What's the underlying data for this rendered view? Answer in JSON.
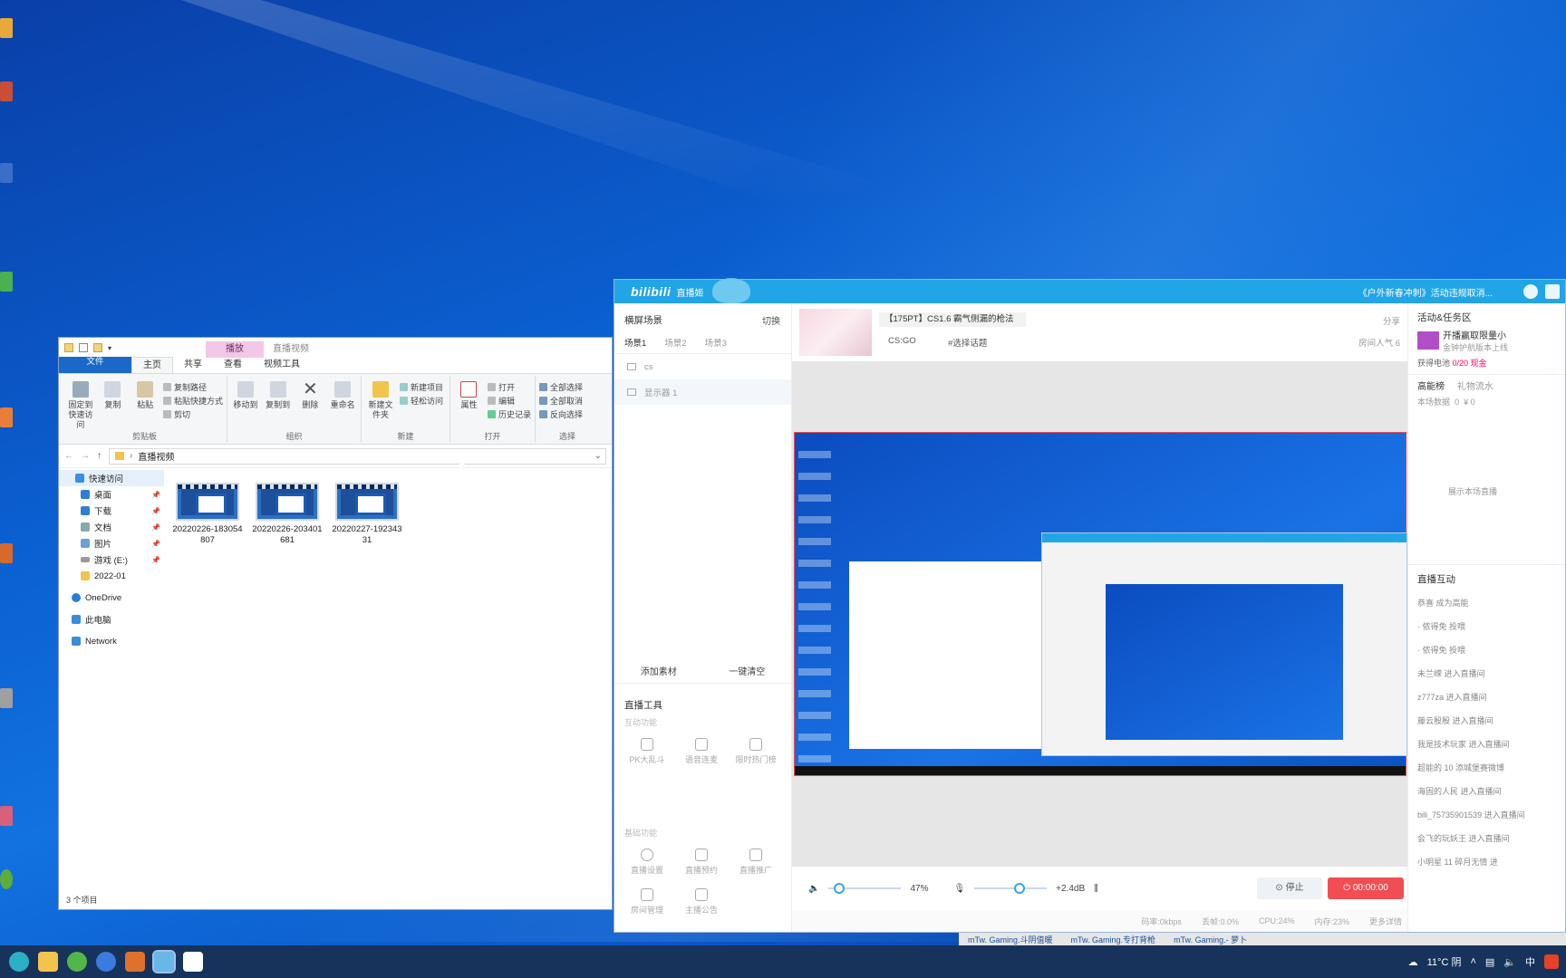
{
  "explorer": {
    "context_tab": "播放",
    "context_tab_sub": "直播视频",
    "tabs": [
      "文件",
      "主页",
      "共享",
      "查看",
      "视频工具"
    ],
    "ribbon": {
      "pin_label": "固定到快速访问",
      "copy_label": "复制",
      "paste_label": "粘贴",
      "copy_path": "复制路径",
      "paste_shortcut": "粘贴快捷方式",
      "cut": "剪切",
      "clipboard_group": "剪贴板",
      "move_to": "移动到",
      "copy_to": "复制到",
      "delete": "删除",
      "rename": "重命名",
      "organize_group": "组织",
      "new_folder": "新建文件夹",
      "new_item": "新建项目",
      "easy_access": "轻松访问",
      "new_group": "新建",
      "properties": "属性",
      "open": "打开",
      "edit": "编辑",
      "history": "历史记录",
      "open_group": "打开",
      "select_all": "全部选择",
      "select_none": "全部取消",
      "invert": "反向选择",
      "select_group": "选择"
    },
    "address": "直播视频",
    "nav": [
      "快速访问",
      "桌面",
      "下载",
      "文档",
      "图片",
      "游戏 (E:)",
      "2022-01",
      "OneDrive",
      "此电脑",
      "Network"
    ],
    "files": [
      "20220226-183054807",
      "20220226-203401681",
      "20220227-19234331"
    ],
    "status": "3 个项目"
  },
  "live": {
    "logo": "bilibili",
    "logo_sub": "直播姬",
    "announcement": "《户外新春冲刺》活动违规取消...",
    "left": {
      "title": "横屏场景",
      "switch": "切换",
      "scenes": [
        "场景1",
        "场景2",
        "场景3"
      ],
      "sources": [
        "cs",
        "显示器 1"
      ],
      "add_source": "添加素材",
      "clear": "一键清空",
      "tools_title": "直播工具",
      "interactive": "互动功能",
      "interactive_tools": [
        "PK大乱斗",
        "语音连麦",
        "限时热门榜"
      ],
      "basic": "基础功能",
      "basic_tools": [
        "直播设置",
        "直播预约",
        "直播推广",
        "房间管理",
        "主播公告"
      ]
    },
    "room": {
      "title": "【175PT】CS1.6 霸气侧漏的枪法",
      "category": "CS:GO",
      "topic": "#选择话题",
      "share": "分享",
      "popularity": "房间人气 6"
    },
    "controls": {
      "volume": "47%",
      "volume_value": 0.47,
      "mic": "+2.4dB",
      "mic_value": 0.62,
      "stop": "停止",
      "timer": "00:00:00"
    },
    "stats": [
      "码率:0kbps",
      "丢帧:0.0%",
      "CPU:24%",
      "内存:23%",
      "更多详情"
    ],
    "right": {
      "activity_title": "活动&任务区",
      "activity_text": "开播赢取限量小",
      "activity_sub": "金钟护航版本上线",
      "battery": "获得电池",
      "battery_count": "0/20",
      "cash": "现金",
      "rank_title": "高能榜",
      "gift_flow": "礼物流水",
      "session": "本场数据",
      "session_a": "0",
      "session_b": "¥ 0",
      "show_hint": "展示本场直播",
      "interact_title": "直播互动",
      "chats": [
        "恭喜  成为高能",
        "· 侬得免 投喂",
        "· 侬得免 投喂",
        "未兰嵘 进入直播间",
        "z777za 进入直播间",
        "藤云殷殷 进入直播间",
        "我是技术玩家 进入直播间",
        "超能的 10 添城堡赛微博",
        "海固的人民 进入直播间",
        "bili_75735901539 进入直播间",
        "会飞的玩妖王 进入直播间",
        "小明星 11 碎月无情 进"
      ]
    }
  },
  "taskbar_ext": [
    "mTw. Gaming.斗阴值暖",
    "mTw. Gaming.专打背枪",
    "mTw. Gaming.- 萝卜"
  ],
  "tray": {
    "weather": "11°C 阴",
    "ime": "中"
  }
}
